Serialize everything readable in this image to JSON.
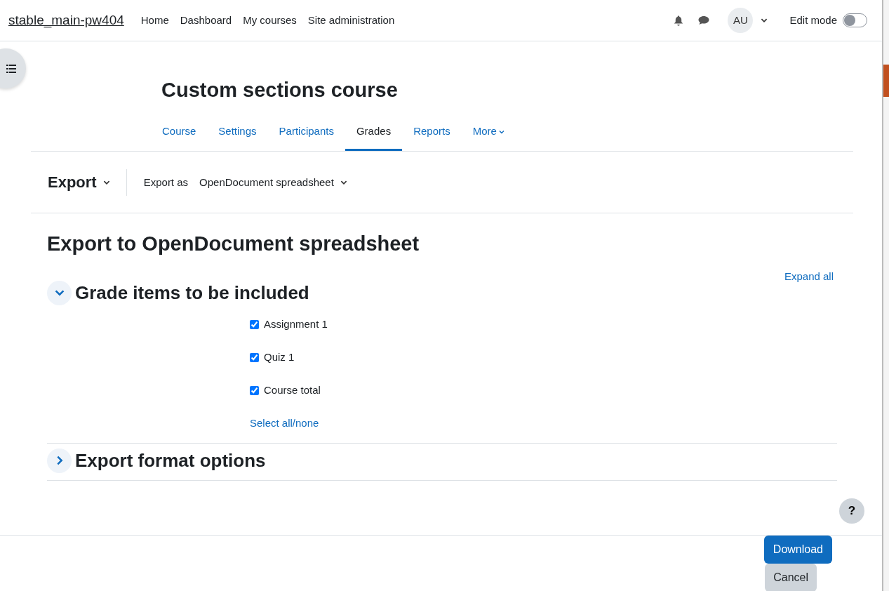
{
  "navbar": {
    "site_name": "stable_main-pw404",
    "links": [
      {
        "label": "Home"
      },
      {
        "label": "Dashboard"
      },
      {
        "label": "My courses"
      },
      {
        "label": "Site administration"
      }
    ],
    "avatar": "AU",
    "edit_mode": {
      "label": "Edit mode",
      "on": false
    }
  },
  "course": {
    "title": "Custom sections course",
    "tabs": [
      {
        "label": "Course",
        "selected": false
      },
      {
        "label": "Settings",
        "selected": false
      },
      {
        "label": "Participants",
        "selected": false
      },
      {
        "label": "Grades",
        "selected": true
      },
      {
        "label": "Reports",
        "selected": false
      },
      {
        "label": "More",
        "selected": false
      }
    ]
  },
  "tertiary_nav": {
    "heading": "Export",
    "export_as_label": "Export as",
    "export_as_value": "OpenDocument spreadsheet"
  },
  "page_title": "Export to OpenDocument spreadsheet",
  "expand_all": "Expand all",
  "sections": [
    {
      "title": "Grade items to be included",
      "expanded": true,
      "items": [
        {
          "label": "Assignment 1",
          "checked": true
        },
        {
          "label": "Quiz 1",
          "checked": true
        },
        {
          "label": "Course total",
          "checked": true
        }
      ],
      "select_all": "Select all/none"
    },
    {
      "title": "Export format options",
      "expanded": false
    }
  ],
  "help_button": "?",
  "footer_buttons": [
    {
      "label": "Download",
      "kind": "primary"
    },
    {
      "label": "Cancel",
      "kind": "secondary"
    }
  ]
}
